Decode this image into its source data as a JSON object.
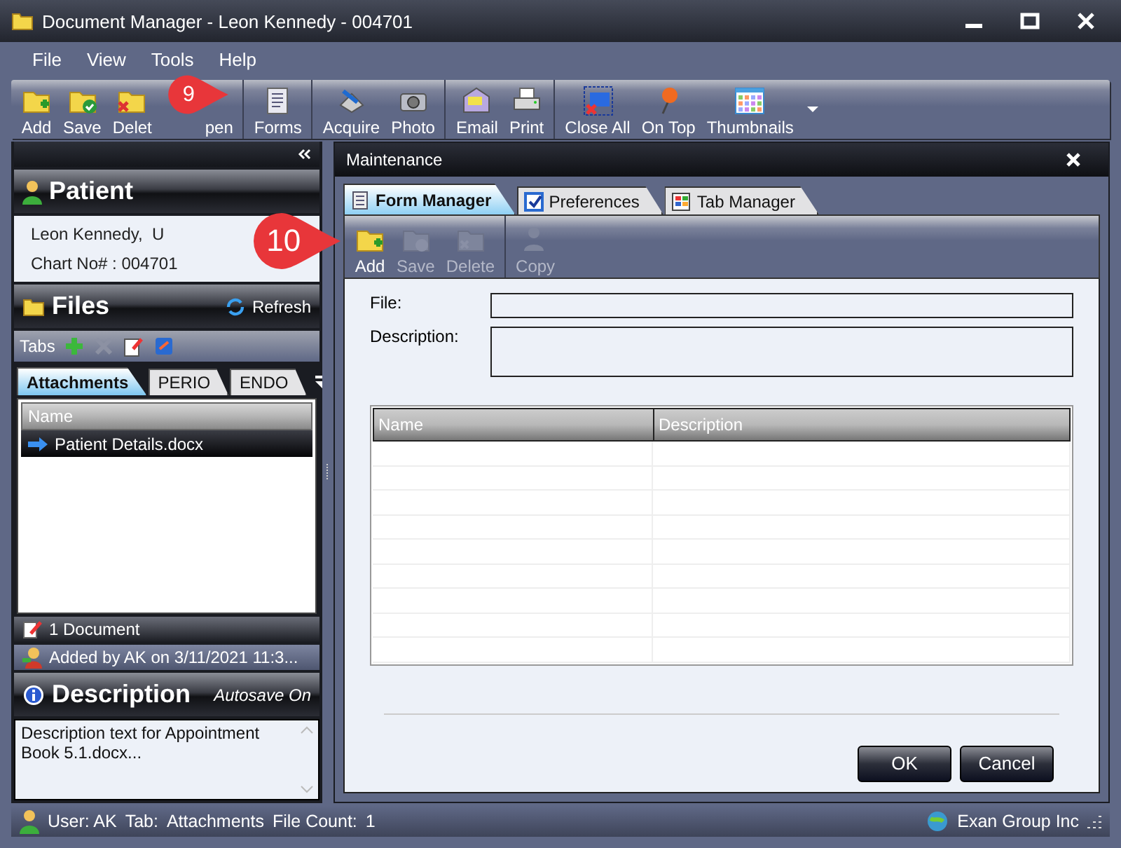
{
  "window": {
    "title": "Document Manager - Leon Kennedy - 004701"
  },
  "menu": [
    "File",
    "View",
    "Tools",
    "Help"
  ],
  "toolbar": {
    "groups": [
      [
        "Add",
        "Save",
        "Delet",
        "pen"
      ],
      [
        "Forms"
      ],
      [
        "Acquire",
        "Photo"
      ],
      [
        "Email",
        "Print"
      ],
      [
        "Close All",
        "On Top",
        "Thumbnails"
      ]
    ]
  },
  "callouts": [
    "9",
    "10"
  ],
  "patient": {
    "title": "Patient",
    "name": "Leon Kennedy,  U",
    "chart": "Chart No# : 004701"
  },
  "files": {
    "title": "Files",
    "refresh": "Refresh",
    "tabs_label": "Tabs",
    "tabs": [
      {
        "label": "Attachments",
        "selected": true
      },
      {
        "label": "PERIO",
        "selected": false
      },
      {
        "label": "ENDO",
        "selected": false
      }
    ],
    "column": "Name",
    "rows": [
      {
        "name": "Patient Details.docx",
        "selected": true
      }
    ],
    "count": "1 Document",
    "added": "Added by AK on 3/11/2021 11:3..."
  },
  "description": {
    "title": "Description",
    "autosave": "Autosave On",
    "text": "Description text for Appointment Book 5.1.docx..."
  },
  "dialog": {
    "title": "Maintenance",
    "tabs": [
      {
        "label": "Form Manager",
        "selected": true
      },
      {
        "label": "Preferences",
        "selected": false
      },
      {
        "label": "Tab Manager",
        "selected": false
      }
    ],
    "toolbar": [
      [
        {
          "label": "Add",
          "disabled": false
        },
        {
          "label": "Save",
          "disabled": true
        },
        {
          "label": "Delete",
          "disabled": true
        }
      ],
      [
        {
          "label": "Copy",
          "disabled": true
        }
      ]
    ],
    "file_label": "File:",
    "description_label": "Description:",
    "columns": [
      "Name",
      "Description"
    ],
    "buttons": [
      "OK",
      "Cancel"
    ]
  },
  "status_bar": {
    "user": "User: AK",
    "tab_label": "Tab:",
    "tab": "Attachments",
    "count_label": "File Count:",
    "count": "1",
    "company": "Exan Group Inc"
  }
}
